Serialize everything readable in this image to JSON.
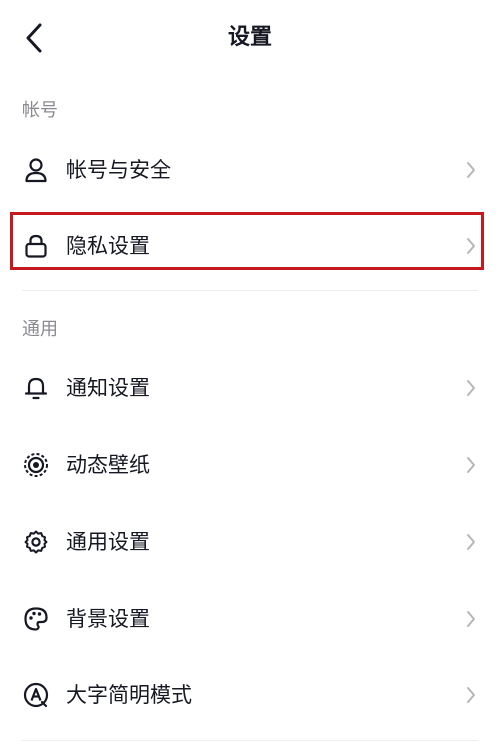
{
  "header": {
    "title": "设置"
  },
  "sections": [
    {
      "label": "帐号",
      "items": [
        {
          "label": "帐号与安全",
          "icon": "user-icon"
        },
        {
          "label": "隐私设置",
          "icon": "lock-icon",
          "highlighted": true
        }
      ]
    },
    {
      "label": "通用",
      "items": [
        {
          "label": "通知设置",
          "icon": "bell-icon"
        },
        {
          "label": "动态壁纸",
          "icon": "live-wallpaper-icon"
        },
        {
          "label": "通用设置",
          "icon": "gear-icon"
        },
        {
          "label": "背景设置",
          "icon": "palette-icon"
        },
        {
          "label": "大字简明模式",
          "icon": "large-text-icon"
        }
      ]
    }
  ],
  "colors": {
    "highlight": "#c8181f",
    "text": "#161823",
    "secondary": "#8a8b91",
    "chevron": "#b5b6ba"
  }
}
